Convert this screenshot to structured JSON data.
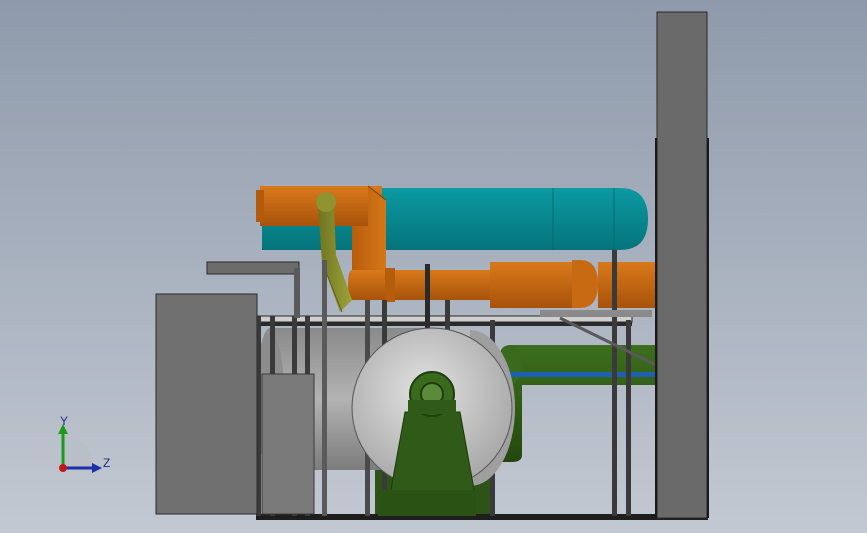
{
  "viewport": {
    "background_top": "#8e9aab",
    "background_bottom": "#c3c9d2"
  },
  "colors": {
    "duct_teal": "#0c8a93",
    "pipe_orange": "#c8670f",
    "pipe_olive": "#8b8f2b",
    "pipe_green": "#2f5a18",
    "housing_gray": "#6f6f6f",
    "drum_silver": "#c9c9c9",
    "frame_dark": "#2a2a2a",
    "blue_rod": "#1d5fb0"
  },
  "triad": {
    "y_label": "Y",
    "z_label": "Z",
    "y_color": "#1a9a1a",
    "z_color": "#1a2fa8",
    "origin_color": "#c01818"
  }
}
